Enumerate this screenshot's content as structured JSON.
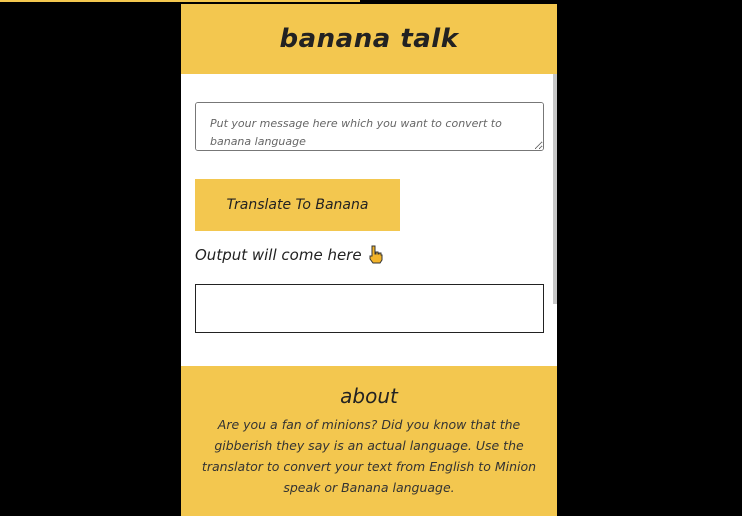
{
  "app": {
    "title": "banana talk"
  },
  "input": {
    "placeholder": "Put your message here which you want to convert to banana language",
    "value": ""
  },
  "translate_button": {
    "label": "Translate To Banana"
  },
  "output": {
    "label": "Output will come here",
    "icon": "pointing-down-hand-icon",
    "value": ""
  },
  "about": {
    "heading": "about",
    "text": "Are you a fan of minions? Did you know that the gibberish they say is an actual language. Use the translator to convert your text from English to Minion speak or Banana language."
  },
  "colors": {
    "accent": "#f3c74f",
    "background": "#000000",
    "surface": "#ffffff",
    "text": "#222222"
  }
}
